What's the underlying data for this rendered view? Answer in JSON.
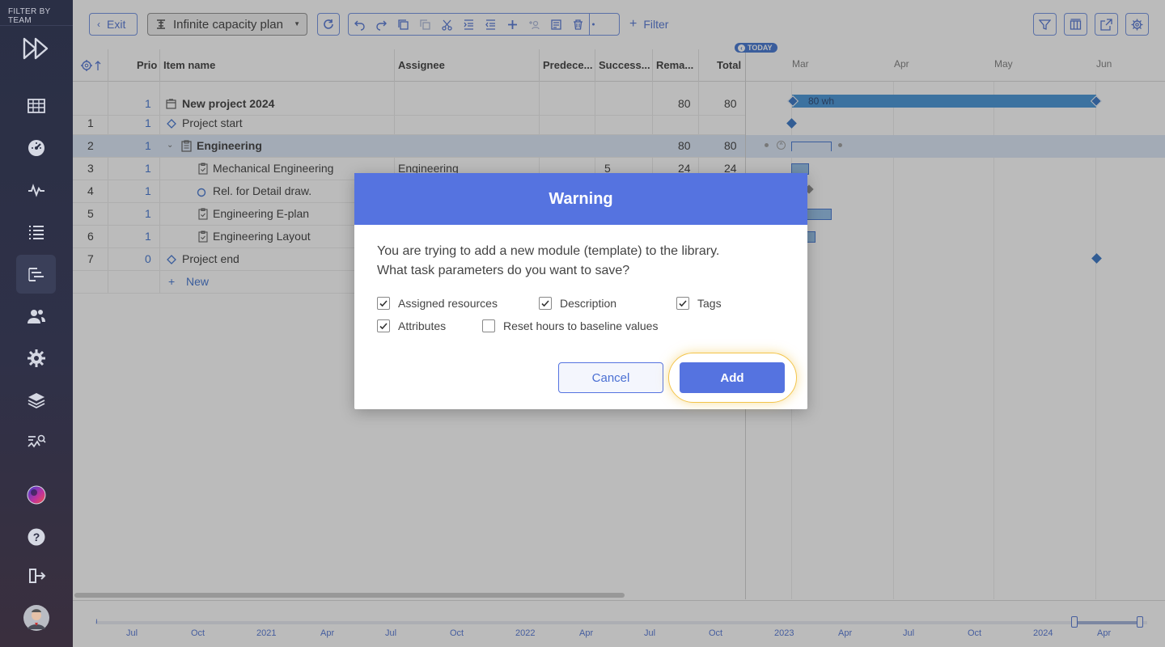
{
  "sidebar": {
    "filter_label": "FILTER BY TEAM",
    "items": [
      {
        "name": "grid-icon"
      },
      {
        "name": "dashboard-icon"
      },
      {
        "name": "activity-icon"
      },
      {
        "name": "list-icon"
      },
      {
        "name": "gantt-icon",
        "active": true
      },
      {
        "name": "users-icon"
      },
      {
        "name": "gear-icon"
      },
      {
        "name": "layers-icon"
      },
      {
        "name": "analytics-icon"
      },
      {
        "name": "globe-avatar-icon"
      },
      {
        "name": "help-icon"
      },
      {
        "name": "logout-icon"
      },
      {
        "name": "user-avatar"
      }
    ]
  },
  "toolbar": {
    "exit_label": "Exit",
    "plan_name": "Infinite capacity plan",
    "filter_label": "Filter"
  },
  "grid": {
    "headers": {
      "prio": "Prio",
      "item_name": "Item name",
      "assignee": "Assignee",
      "predecessors": "Predece...",
      "successors": "Success...",
      "remaining": "Rema...",
      "total": "Total"
    },
    "rows": [
      {
        "num": "",
        "prio": "1",
        "name": "New project 2024",
        "assignee": "",
        "succ": "",
        "rem": "80",
        "total": "80",
        "bold": true
      },
      {
        "num": "1",
        "prio": "1",
        "name": "Project start",
        "assignee": "",
        "succ": "",
        "rem": "",
        "total": ""
      },
      {
        "num": "2",
        "prio": "1",
        "name": "Engineering",
        "assignee": "",
        "succ": "",
        "rem": "80",
        "total": "80",
        "bold": true
      },
      {
        "num": "3",
        "prio": "1",
        "name": "Mechanical Engineering",
        "assignee": "Engineering",
        "succ": "5",
        "rem": "24",
        "total": "24"
      },
      {
        "num": "4",
        "prio": "1",
        "name": "Rel. for Detail draw.",
        "assignee": "",
        "succ": "",
        "rem": "",
        "total": ""
      },
      {
        "num": "5",
        "prio": "1",
        "name": "Engineering E-plan",
        "assignee": "",
        "succ": "",
        "rem": "",
        "total": ""
      },
      {
        "num": "6",
        "prio": "1",
        "name": "Engineering Layout",
        "assignee": "",
        "succ": "",
        "rem": "",
        "total": ""
      },
      {
        "num": "7",
        "prio": "0",
        "name": "Project end",
        "assignee": "",
        "succ": "",
        "rem": "",
        "total": ""
      }
    ],
    "new_label": "New"
  },
  "gantt": {
    "today_label": "TODAY",
    "months": [
      "Mar",
      "Apr",
      "May",
      "Jun"
    ],
    "bar_label": "80 wh"
  },
  "timeline": {
    "labels": [
      "Jul",
      "Oct",
      "2021",
      "Apr",
      "Jul",
      "Oct",
      "2022",
      "Apr",
      "Jul",
      "Oct",
      "2023",
      "Apr",
      "Jul",
      "Oct",
      "2024",
      "Apr"
    ]
  },
  "modal": {
    "title": "Warning",
    "message_line1": "You are trying to add a new module (template) to the library.",
    "message_line2": "What task parameters do you want to save?",
    "options": {
      "assigned_resources": {
        "label": "Assigned resources",
        "checked": true
      },
      "description": {
        "label": "Description",
        "checked": true
      },
      "tags": {
        "label": "Tags",
        "checked": true
      },
      "attributes": {
        "label": "Attributes",
        "checked": true
      },
      "reset_hours": {
        "label": "Reset hours to baseline values",
        "checked": false
      }
    },
    "cancel_label": "Cancel",
    "add_label": "Add"
  },
  "colors": {
    "accent": "#5573e0",
    "sidebar_bg": "#2a2f45",
    "bar_blue": "#3d8fd6",
    "highlight": "#f3c44a"
  }
}
